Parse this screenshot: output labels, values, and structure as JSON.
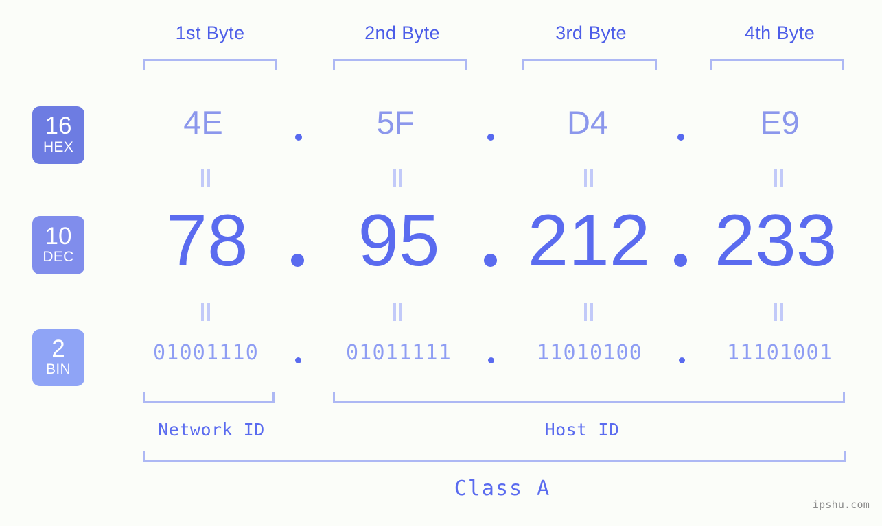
{
  "meta": {
    "watermark": "ipshu.com",
    "background_color": "#fbfdf9",
    "accent_color": "#5a6bef",
    "light_accent_color": "#adb8f4"
  },
  "headers": {
    "bytes": [
      {
        "label": "1st Byte"
      },
      {
        "label": "2nd Byte"
      },
      {
        "label": "3rd Byte"
      },
      {
        "label": "4th Byte"
      }
    ]
  },
  "bases": [
    {
      "number": "16",
      "abbr": "HEX",
      "color": "#6d7ce2"
    },
    {
      "number": "10",
      "abbr": "DEC",
      "color": "#808dec"
    },
    {
      "number": "2",
      "abbr": "BIN",
      "color": "#8fa4f6"
    }
  ],
  "rows": {
    "hex": {
      "values": [
        "4E",
        "5F",
        "D4",
        "E9"
      ],
      "separator": "."
    },
    "dec": {
      "values": [
        "78",
        "95",
        "212",
        "233"
      ],
      "separator": "."
    },
    "bin": {
      "values": [
        "01001110",
        "01011111",
        "11010100",
        "11101001"
      ],
      "separator": "."
    }
  },
  "footer": {
    "network_id_label": "Network ID",
    "host_id_label": "Host ID",
    "class_label": "Class A"
  }
}
